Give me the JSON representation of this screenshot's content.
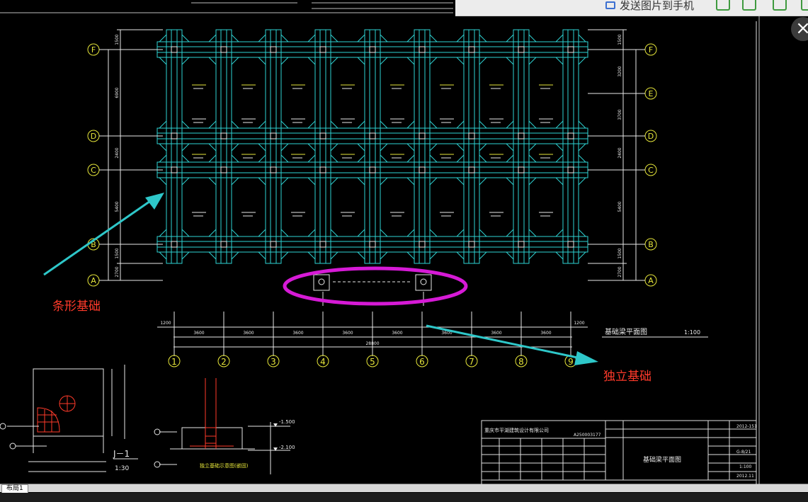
{
  "toolbar": {
    "send_label": "发送图片到手机"
  },
  "drawing": {
    "annotation_strip": "条形基础",
    "annotation_isolated": "独立基础",
    "plan_title": "基础梁平面图",
    "plan_scale": "1:100",
    "grid_rows": [
      "F",
      "E",
      "D",
      "C",
      "B",
      "A"
    ],
    "grid_cols": [
      "1",
      "2",
      "3",
      "4",
      "5",
      "6",
      "7",
      "8",
      "9"
    ],
    "bay_dims": [
      "3600",
      "3600",
      "3600",
      "3600",
      "3600",
      "3600",
      "3600",
      "3600"
    ],
    "total_dim": "28800",
    "edge_dim": "1200",
    "left_row_dims": [
      "1500",
      "6900",
      "2400",
      "5400",
      "1500",
      "2700"
    ],
    "right_row_dims": [
      "1500",
      "3200",
      "3700",
      "2400",
      "5400",
      "1500",
      "2700"
    ],
    "footing_label": "J－1",
    "footing_scale": "1:30",
    "section_note": "独立基础示意图(嵌固)",
    "elevation_top": "-1.500",
    "elevation_bottom": "-2.100",
    "company": "重庆市平湖建筑设计有限公司",
    "cert_no": "A250003177",
    "sheet_title": "基础梁平面图",
    "drawing_no": "G-8/21",
    "sheet_scale": "1:100",
    "date": "2012.11",
    "project_no": "2012-151"
  },
  "status": {
    "layout_tab": "布局1"
  },
  "colors": {
    "background": "#000000",
    "beam": "#2ed3d3",
    "annotation_text": "#ff3a2a",
    "arrow": "#2ec7c9",
    "ellipse": "#d61ad6",
    "grid_bubble": "#e6e63a",
    "frame": "#e0e0e0"
  }
}
